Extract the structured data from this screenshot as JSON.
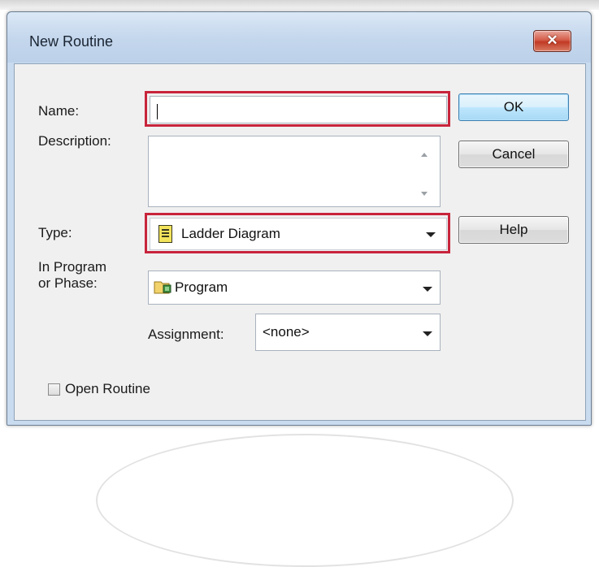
{
  "window": {
    "title": "New Routine",
    "close_glyph": "✕"
  },
  "form": {
    "name_label": "Name:",
    "name_value": "",
    "description_label": "Description:",
    "description_value": "",
    "type_label": "Type:",
    "type_value": "Ladder Diagram",
    "type_icon": "ladder-diagram-icon",
    "program_label_line1": "In Program",
    "program_label_line2": "or Phase:",
    "program_value": "Program",
    "program_icon": "program-folder-icon",
    "assignment_label": "Assignment:",
    "assignment_value": "<none>",
    "open_routine_label": "Open Routine",
    "open_routine_checked": false
  },
  "buttons": {
    "ok": "OK",
    "cancel": "Cancel",
    "help": "Help"
  },
  "colors": {
    "highlight": "#c8243c",
    "close_button": "#c13a24",
    "title_bar": "#c3d6ec"
  }
}
